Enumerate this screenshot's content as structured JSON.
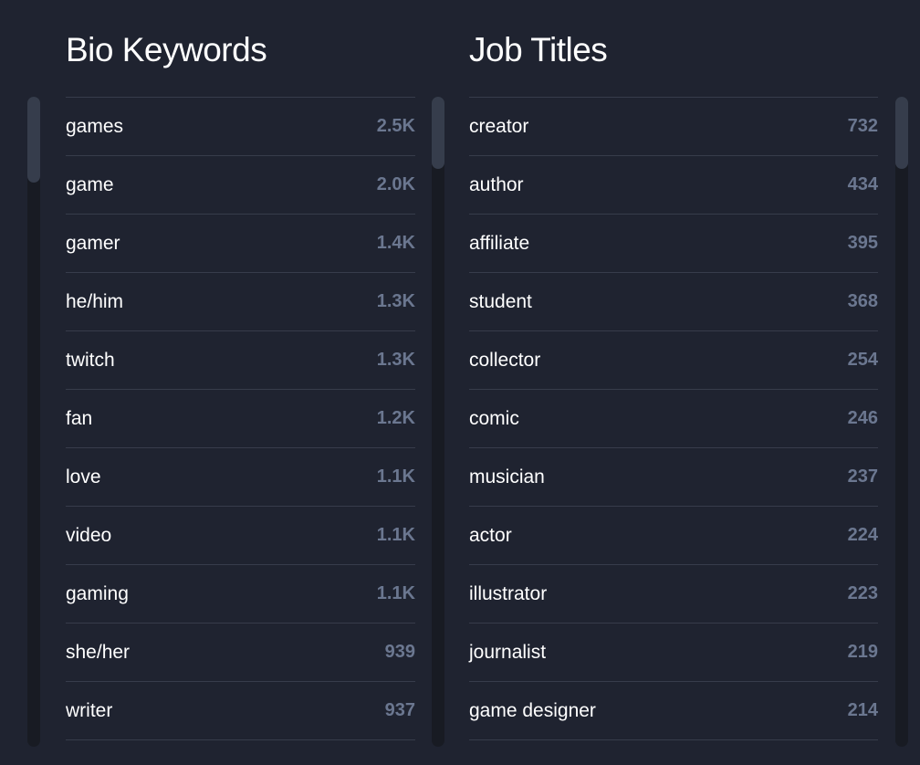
{
  "bio_keywords": {
    "title": "Bio Keywords",
    "items": [
      {
        "label": "games",
        "value": "2.5K"
      },
      {
        "label": "game",
        "value": "2.0K"
      },
      {
        "label": "gamer",
        "value": "1.4K"
      },
      {
        "label": "he/him",
        "value": "1.3K"
      },
      {
        "label": "twitch",
        "value": "1.3K"
      },
      {
        "label": "fan",
        "value": "1.2K"
      },
      {
        "label": "love",
        "value": "1.1K"
      },
      {
        "label": "video",
        "value": "1.1K"
      },
      {
        "label": "gaming",
        "value": "1.1K"
      },
      {
        "label": "she/her",
        "value": "939"
      },
      {
        "label": "writer",
        "value": "937"
      }
    ]
  },
  "job_titles": {
    "title": "Job Titles",
    "items": [
      {
        "label": "creator",
        "value": "732"
      },
      {
        "label": "author",
        "value": "434"
      },
      {
        "label": "affiliate",
        "value": "395"
      },
      {
        "label": "student",
        "value": "368"
      },
      {
        "label": "collector",
        "value": "254"
      },
      {
        "label": "comic",
        "value": "246"
      },
      {
        "label": "musician",
        "value": "237"
      },
      {
        "label": "actor",
        "value": "224"
      },
      {
        "label": "illustrator",
        "value": "223"
      },
      {
        "label": "journalist",
        "value": "219"
      },
      {
        "label": "game designer",
        "value": "214"
      }
    ]
  },
  "colors": {
    "background": "#1f2330",
    "divider": "#373c4b",
    "label_text": "#ffffff",
    "value_text": "#6b7790",
    "scroll_track": "#181b23",
    "scroll_thumb": "#363d4c"
  }
}
